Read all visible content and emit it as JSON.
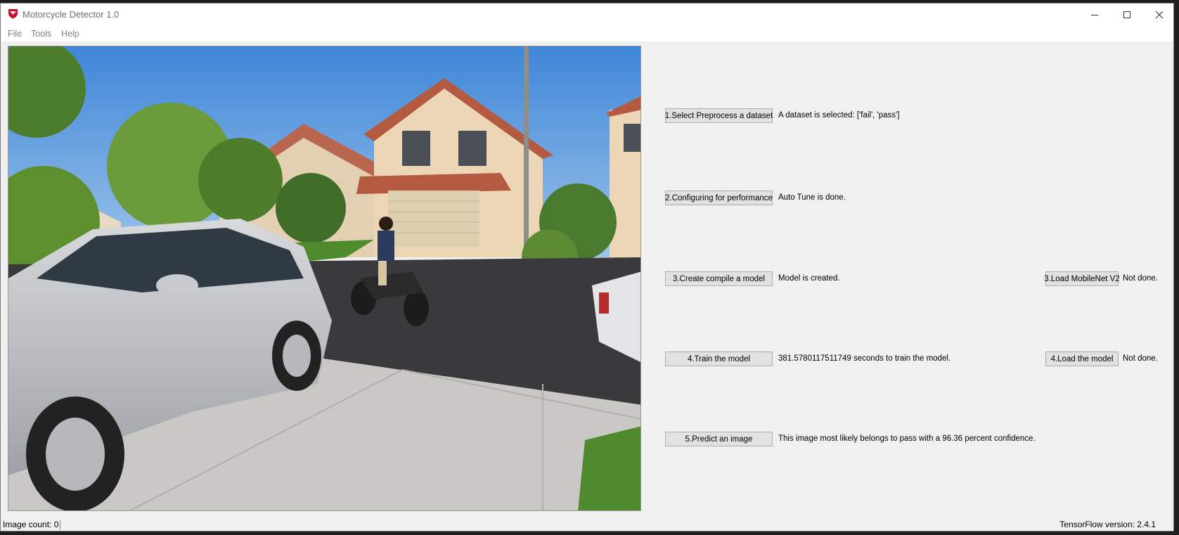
{
  "window": {
    "title": "Motorcycle Detector 1.0",
    "icon": "ducati-shield-icon"
  },
  "menu": [
    "File",
    "Tools",
    "Help"
  ],
  "actions": {
    "select_dataset": {
      "label": "1.Select  Preprocess a dataset",
      "status": "A dataset is selected: ['fail', 'pass']"
    },
    "configure": {
      "label": "2.Configuring for performance",
      "status": "Auto Tune is done."
    },
    "create_model": {
      "label": "3.Create  compile a model",
      "status": "Model is created."
    },
    "load_mobilenet": {
      "label": "3.Load MobileNet V2",
      "status": "Not done."
    },
    "train_model": {
      "label": "4.Train the model",
      "status": "381.5780117511749 seconds to train the model."
    },
    "load_model": {
      "label": "4.Load the model",
      "status": "Not done."
    },
    "predict": {
      "label": "5.Predict an image",
      "status": "This image most likely belongs to pass with a 96.36 percent confidence."
    }
  },
  "footer": {
    "image_count_label": "Image count:",
    "image_count_value": "0",
    "tf_version": "TensorFlow version: 2.4.1"
  },
  "colors": {
    "window_bg": "#f0f0f0",
    "button_bg": "#e1e1e1",
    "sky": "#5e9ad6"
  }
}
